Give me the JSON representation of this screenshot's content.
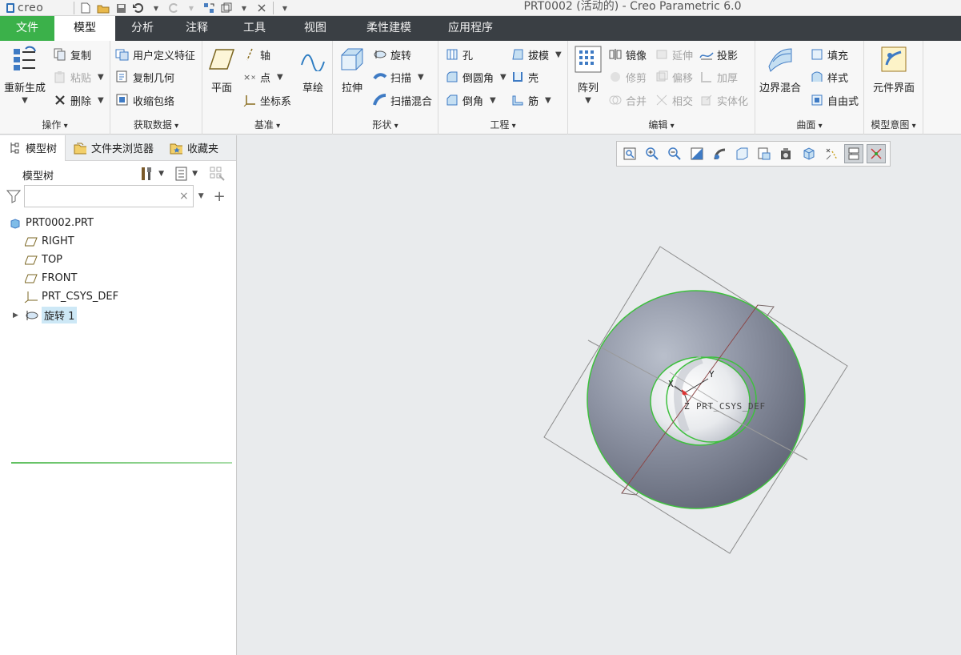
{
  "app": {
    "logo_text": "creo",
    "window_title": "PRT0002 (活动的) - Creo Parametric 6.0"
  },
  "menu": {
    "tabs": [
      {
        "label": "文件"
      },
      {
        "label": "模型"
      },
      {
        "label": "分析"
      },
      {
        "label": "注释"
      },
      {
        "label": "工具"
      },
      {
        "label": "视图"
      },
      {
        "label": "柔性建模"
      },
      {
        "label": "应用程序"
      }
    ],
    "active_index": 1
  },
  "ribbon": {
    "operations": {
      "label": "操作",
      "regenerate": "重新生成",
      "copy": "复制",
      "paste": "粘贴",
      "delete": "删除"
    },
    "get_data": {
      "label": "获取数据",
      "udf": "用户定义特征",
      "copy_geom": "复制几何",
      "shrinkwrap": "收缩包络"
    },
    "datum": {
      "label": "基准",
      "plane": "平面",
      "axis": "轴",
      "point": "点",
      "csys": "坐标系",
      "sketch": "草绘"
    },
    "shapes": {
      "label": "形状",
      "extrude": "拉伸",
      "revolve": "旋转",
      "sweep": "扫描",
      "swept_blend": "扫描混合"
    },
    "engineering": {
      "label": "工程",
      "hole": "孔",
      "round": "倒圆角",
      "chamfer": "倒角",
      "draft": "拔模",
      "shell": "壳",
      "rib": "筋"
    },
    "editing": {
      "label": "编辑",
      "pattern": "阵列",
      "mirror": "镜像",
      "trim": "修剪",
      "merge": "合并",
      "extend": "延伸",
      "offset": "偏移",
      "intersect": "相交",
      "project": "投影",
      "thicken": "加厚",
      "solidify": "实体化"
    },
    "surfaces": {
      "label": "曲面",
      "boundary_blend": "边界混合",
      "fill": "填充",
      "style": "样式",
      "freestyle": "自由式"
    },
    "model_intent": {
      "label": "模型意图",
      "component_interface": "元件界面"
    }
  },
  "panel": {
    "tabs": [
      {
        "label": "模型树"
      },
      {
        "label": "文件夹浏览器"
      },
      {
        "label": "收藏夹"
      }
    ],
    "tree_title": "模型树",
    "search": {
      "value": "",
      "placeholder": ""
    },
    "tree": [
      {
        "label": "PRT0002.PRT",
        "icon": "part-icon"
      },
      {
        "label": "RIGHT",
        "icon": "datum-plane-icon"
      },
      {
        "label": "TOP",
        "icon": "datum-plane-icon"
      },
      {
        "label": "FRONT",
        "icon": "datum-plane-icon"
      },
      {
        "label": "PRT_CSYS_DEF",
        "icon": "csys-icon"
      },
      {
        "label": "旋转 1",
        "icon": "revolve-icon",
        "selected": true
      }
    ]
  },
  "viewport": {
    "csys_label": "PRT_CSYS_DEF",
    "axis_x": "X",
    "axis_y": "Y",
    "axis_z": "Z"
  },
  "colors": {
    "accent_green": "#3bb14a",
    "menubar": "#3a3f44",
    "selection": "#cde8f6",
    "edge_highlight": "#3ec03e"
  }
}
